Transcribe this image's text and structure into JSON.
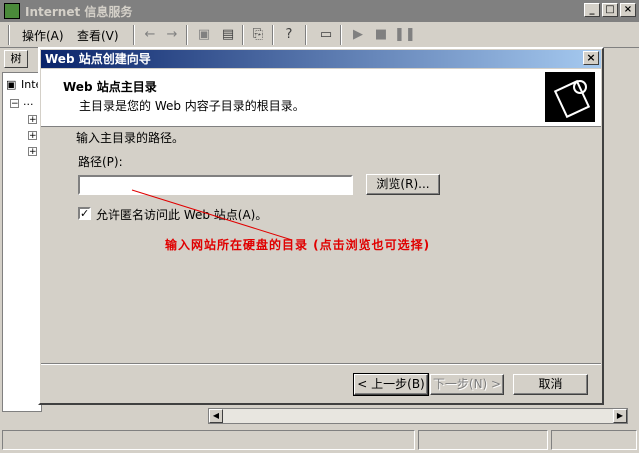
{
  "window": {
    "title": "Internet 信息服务",
    "buttons": [
      "_",
      "□",
      "×"
    ]
  },
  "menubar": {
    "items": [
      "操作(A)",
      "查看(V)"
    ],
    "toolbar_icons": [
      "back-arrow",
      "forward-arrow",
      "folder",
      "properties",
      "export",
      "help",
      "computer",
      "play",
      "stop",
      "pause"
    ]
  },
  "tree": {
    "tab_label": "树",
    "root_label": "Inte",
    "child_label": "..."
  },
  "wizard": {
    "title": "Web 站点创建向导",
    "close": "×",
    "header_title": "Web 站点主目录",
    "header_subtitle": "主目录是您的 Web 内容子目录的根目录。",
    "instruction": "输入主目录的路径。",
    "path_label": "路径(P):",
    "path_value": "",
    "browse_button": "浏览(R)...",
    "allow_anon_label": "允许匿名访问此 Web 站点(A)。",
    "allow_anon_checked": true,
    "checkmark": "✓",
    "back_button": "< 上一步(B)",
    "next_button": "下一步(N) >",
    "cancel_button": "取消"
  },
  "annotation": {
    "text": "输入网站所在硬盘的目录 (点击浏览也可选择)",
    "color": "#e00000"
  }
}
